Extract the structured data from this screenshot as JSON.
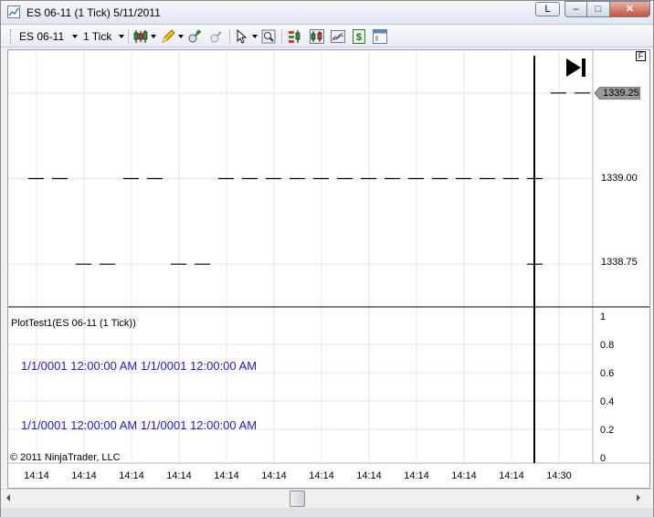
{
  "window": {
    "title": "ES 06-11 (1 Tick)  5/11/2011",
    "l_button": "L",
    "min_glyph": "–",
    "max_glyph": "□",
    "close_glyph": "✕"
  },
  "toolbar": {
    "instrument": "ES 06-11",
    "interval": "1 Tick"
  },
  "price_panel": {
    "last_price": "1339.25",
    "axis_labels": [
      "1339.00",
      "1338.75"
    ],
    "f_marker": "F"
  },
  "indicator_panel": {
    "title": "PlotTest1(ES 06-11 (1 Tick))",
    "text_line_1": "1/1/0001 12:00:00 AM 1/1/0001 12:00:00 AM",
    "text_line_2": "1/1/0001 12:00:00 AM 1/1/0001 12:00:00 AM",
    "axis_labels": [
      "1",
      "0.8",
      "0.6",
      "0.4",
      "0.2",
      "0"
    ],
    "text_color": "#1a1ad8"
  },
  "time_axis": {
    "labels": [
      "14:14",
      "14:14",
      "14:14",
      "14:14",
      "14:14",
      "14:14",
      "14:14",
      "14:14",
      "14:14",
      "14:14",
      "14:14",
      "14:30"
    ]
  },
  "footer": {
    "copyright": "© 2011 NinjaTrader, LLC"
  },
  "chart_data": {
    "type": "scatter",
    "title": "",
    "series": [
      {
        "x": [
          "14:14",
          "14:14",
          "14:14",
          "14:14",
          "14:14",
          "14:14",
          "14:14",
          "14:14",
          "14:14",
          "14:14",
          "14:14",
          "14:14",
          "14:14",
          "14:14",
          "14:14",
          "14:14",
          "14:14",
          "14:14",
          "14:14",
          "14:14",
          "14:14",
          "14:14",
          "14:30",
          "14:30"
        ],
        "values": [
          1339.0,
          1339.0,
          1338.75,
          1338.75,
          1339.0,
          1339.0,
          1338.75,
          1338.75,
          1339.0,
          1339.0,
          1339.0,
          1339.0,
          1339.0,
          1339.0,
          1339.0,
          1339.0,
          1339.0,
          1339.0,
          1339.0,
          1339.0,
          1339.0,
          1339.0,
          1338.75,
          1339.25
        ]
      }
    ],
    "ylim": [
      1338.625,
      1339.375
    ],
    "y_ticks": [
      1338.75,
      1339.0,
      1339.25
    ],
    "grid": true,
    "price_axis_side": "right"
  },
  "colors": {
    "bar_color": "#000000",
    "grid_color": "#e3e3e3",
    "last_price_bg": "#9a9a9a"
  },
  "icons": [
    "chart-app-icon",
    "candlestick-icon",
    "pencil-icon",
    "zoom-in-icon",
    "zoom-out-icon",
    "pointer-icon",
    "magnifier-icon",
    "strategy-icon",
    "indicators-icon",
    "data-box-icon",
    "dollar-icon",
    "properties-icon",
    "jump-to-end-icon"
  ]
}
